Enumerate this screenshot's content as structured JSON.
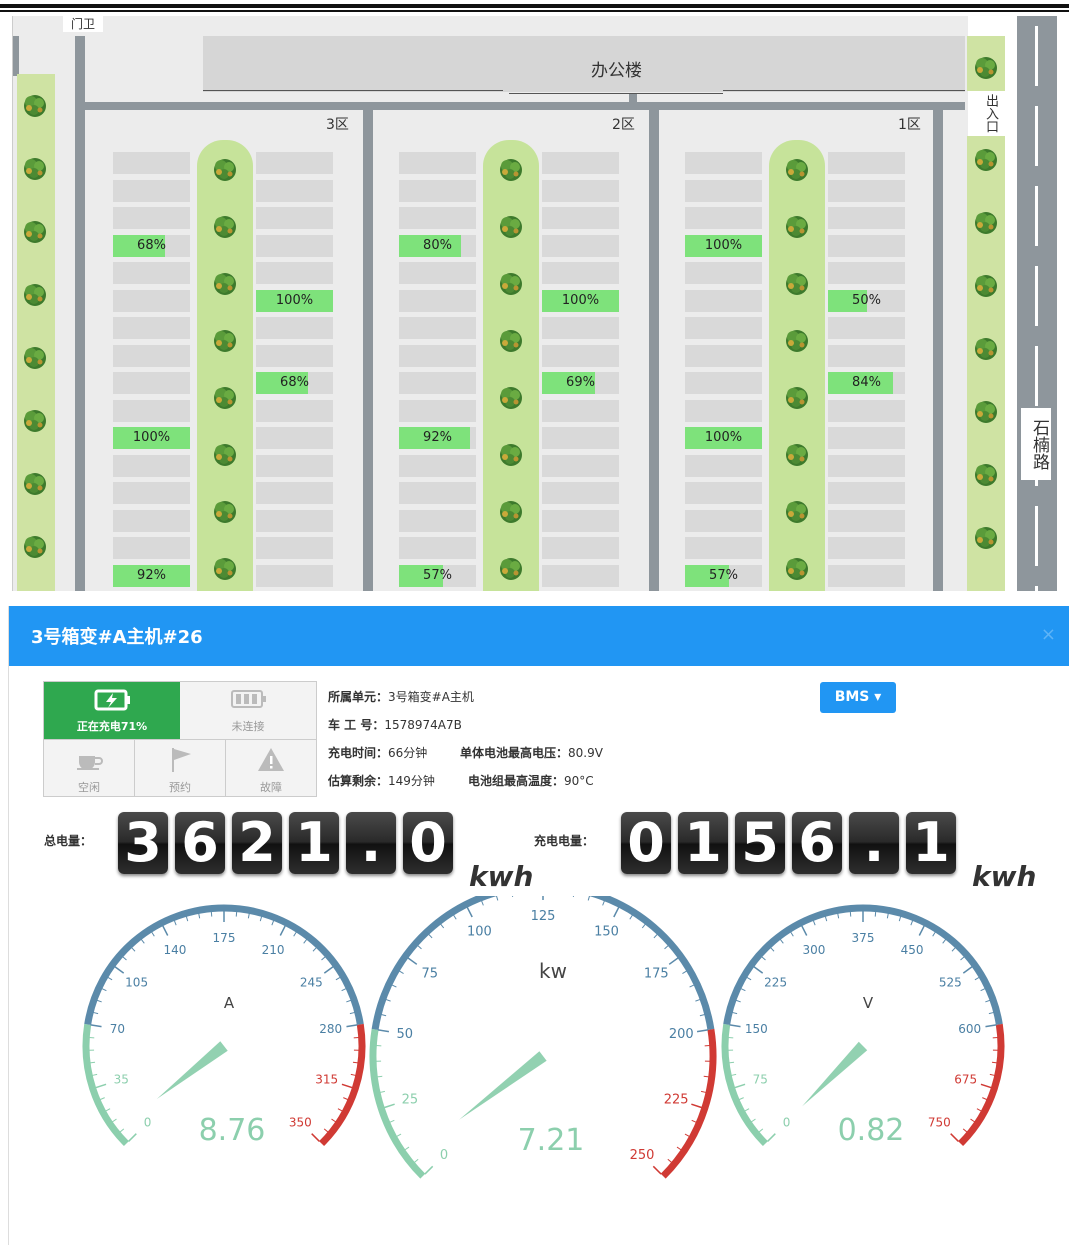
{
  "map": {
    "office_label": "办公楼",
    "gate_label": "门卫",
    "exit_label": "出入口",
    "road_label": "石楠路",
    "zones": [
      {
        "label": "3区",
        "left_chargers": [
          "68%",
          "100%",
          "92%"
        ],
        "right_chargers": [
          "100%",
          "68%"
        ],
        "left_values": [
          68,
          100,
          100
        ],
        "right_values": [
          100,
          68
        ]
      },
      {
        "label": "2区",
        "left_chargers": [
          "80%",
          "92%",
          "57%"
        ],
        "right_chargers": [
          "100%",
          "69%"
        ],
        "left_values": [
          80,
          92,
          57
        ],
        "right_values": [
          100,
          69
        ]
      },
      {
        "label": "1区",
        "left_chargers": [
          "100%",
          "100%",
          "57%"
        ],
        "right_chargers": [
          "50%",
          "84%"
        ],
        "left_values": [
          100,
          100,
          57
        ],
        "right_values": [
          50,
          84
        ]
      }
    ]
  },
  "dialog": {
    "title": "3号箱变#A主机#26",
    "close": "×",
    "status": {
      "charging": "正在充电71%",
      "disconnected": "未连接",
      "idle": "空闲",
      "reserved": "预约",
      "fault": "故障"
    },
    "info": {
      "unit_label": "所属单元：",
      "unit_value": "3号箱变#A主机",
      "id_label": "车 工 号：",
      "id_value": "1578974A7B",
      "time_label": "充电时间：",
      "time_value": "66分钟",
      "maxv_label": "单体电池最高电压：",
      "maxv_value": "80.9V",
      "remain_label": "估算剩余：",
      "remain_value": "149分钟",
      "maxt_label": "电池组最高温度：",
      "maxt_value": "90°C"
    },
    "bms_button": "BMS ▾",
    "counters": {
      "total_label": "总电量：",
      "total_digits": [
        "3",
        "6",
        "2",
        "1",
        ".",
        "0"
      ],
      "charge_label": "充电电量：",
      "charge_digits": [
        "0",
        "1",
        "5",
        "6",
        ".",
        "1"
      ],
      "unit": "kwh"
    },
    "gauges": [
      {
        "id": "current",
        "unit": "A",
        "value": "8.76",
        "numeric": 8.76,
        "min": 0,
        "max": 350,
        "ticks": [
          "0",
          "35",
          "70",
          "105",
          "140",
          "175",
          "210",
          "245",
          "280",
          "315",
          "350"
        ]
      },
      {
        "id": "power",
        "unit": "kw",
        "value": "7.21",
        "numeric": 7.21,
        "min": 0,
        "max": 250,
        "ticks": [
          "0",
          "25",
          "50",
          "75",
          "100",
          "125",
          "150",
          "175",
          "200",
          "225",
          "250"
        ]
      },
      {
        "id": "voltage",
        "unit": "V",
        "value": "0.82",
        "numeric": 0.82,
        "min": 0,
        "max": 750,
        "ticks": [
          "0",
          "75",
          "150",
          "225",
          "300",
          "375",
          "450",
          "525",
          "600",
          "675",
          "750"
        ]
      }
    ],
    "colors": {
      "green": "#8ccfad",
      "blue": "#5b8aaa",
      "red": "#d03a34",
      "tick_text": "#4a7fa3",
      "value_text": "#8ccfad"
    }
  }
}
